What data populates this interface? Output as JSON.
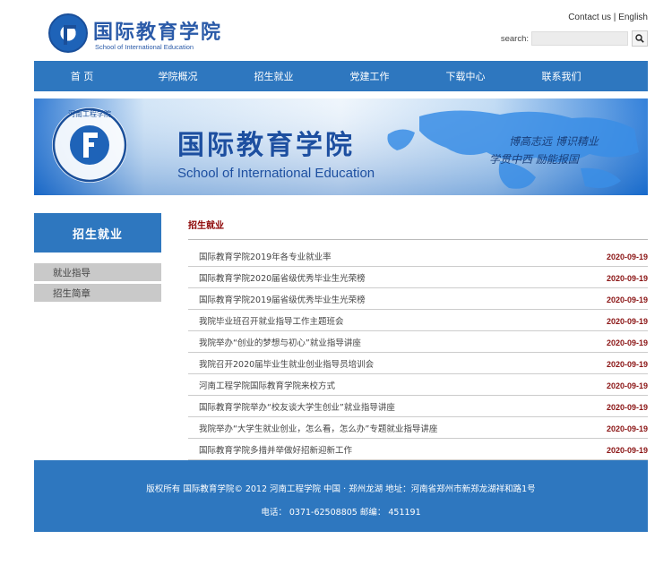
{
  "header": {
    "logo_cn": "国际教育学院",
    "logo_en": "School of International Education",
    "contact": "Contact us",
    "separator": "|",
    "english": "English",
    "search_label": "search:",
    "search_placeholder": "",
    "search_icon": "search-icon"
  },
  "nav": {
    "items": [
      "首 页",
      "学院概况",
      "招生就业",
      "党建工作",
      "下载中心",
      "联系我们"
    ]
  },
  "banner": {
    "seal_text": "河南工程学院",
    "title_cn": "国际教育学院",
    "title_en": "School of International Education",
    "motto_1": "博高志远  博识精业",
    "motto_2": "学贯中西  励能报国",
    "colors": {
      "sky_top": "#1a6fd0",
      "sky_light": "#e8f2fb",
      "map": "#2f86e0"
    }
  },
  "sidebar": {
    "title": "招生就业",
    "items": [
      "就业指导",
      "招生简章"
    ]
  },
  "content": {
    "title": "招生就业",
    "news": [
      {
        "title": "国际教育学院2019年各专业就业率",
        "date": "2020-09-19"
      },
      {
        "title": "国际教育学院2020届省级优秀毕业生光荣榜",
        "date": "2020-09-19"
      },
      {
        "title": "国际教育学院2019届省级优秀毕业生光荣榜",
        "date": "2020-09-19"
      },
      {
        "title": "我院毕业班召开就业指导工作主题班会",
        "date": "2020-09-19"
      },
      {
        "title": "我院举办“创业的梦想与初心”就业指导讲座",
        "date": "2020-09-19"
      },
      {
        "title": "我院召开2020届毕业生就业创业指导员培训会",
        "date": "2020-09-19"
      },
      {
        "title": "河南工程学院国际教育学院来校方式",
        "date": "2020-09-19"
      },
      {
        "title": "国际教育学院举办“校友谈大学生创业”就业指导讲座",
        "date": "2020-09-19"
      },
      {
        "title": "我院举办“大学生就业创业，怎么看，怎么办”专题就业指导讲座",
        "date": "2020-09-19"
      },
      {
        "title": "国际教育学院多措并举做好招新迎新工作",
        "date": "2020-09-19"
      }
    ]
  },
  "footer": {
    "line1": "版权所有 国际教育学院© 2012 河南工程学院 中国 · 郑州龙湖 地址：河南省郑州市新郑龙湖祥和路1号",
    "line2": "电话： 0371-62508805 邮编： 451191"
  }
}
